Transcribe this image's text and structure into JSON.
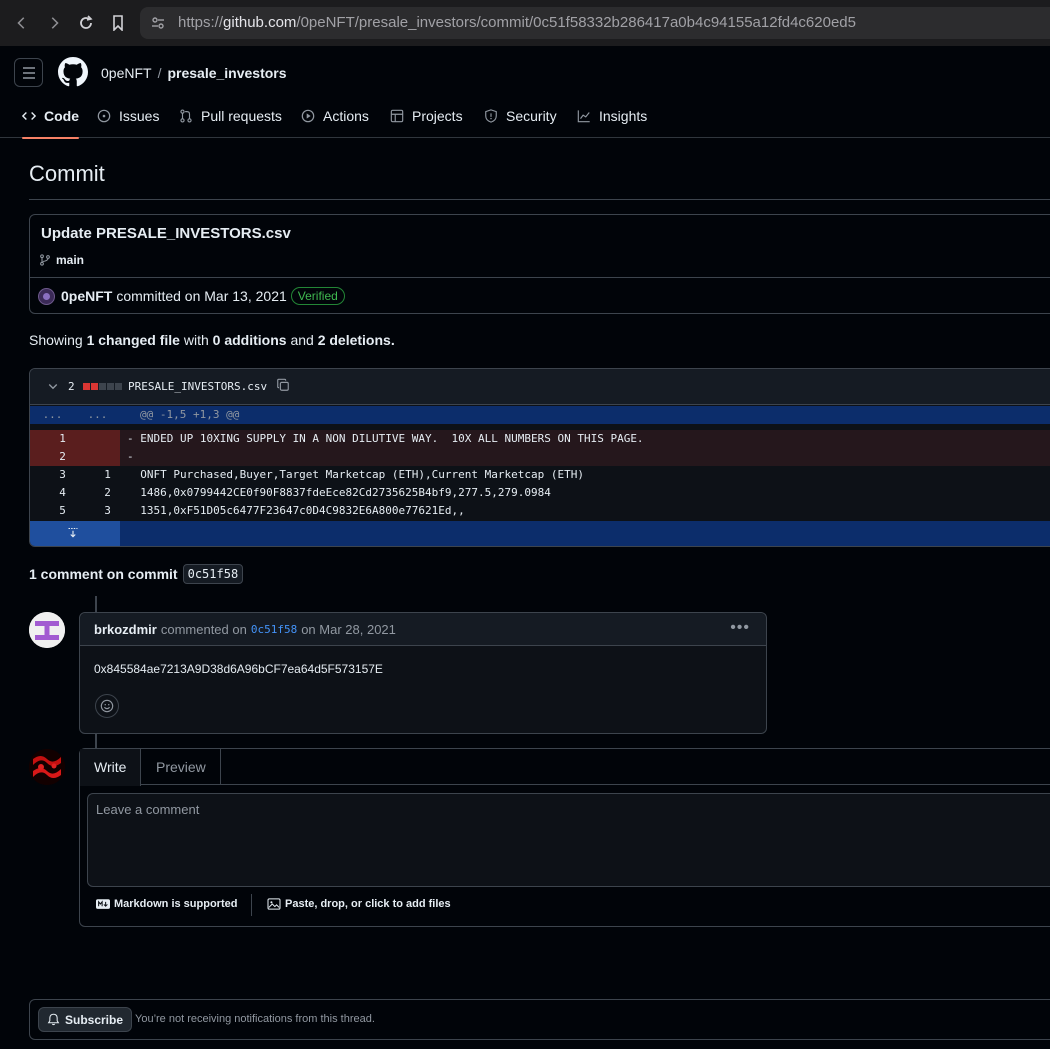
{
  "browser": {
    "url_prefix": "https://",
    "url_host": "github.com",
    "url_path": "/0peNFT/presale_investors/commit/0c51f58332b286417a0b4c94155a12fd4c620ed5"
  },
  "header": {
    "owner": "0peNFT",
    "separator": "/",
    "repo": "presale_investors",
    "tabs": [
      {
        "label": "Code",
        "icon": "code-icon"
      },
      {
        "label": "Issues",
        "icon": "issue-icon"
      },
      {
        "label": "Pull requests",
        "icon": "pull-request-icon"
      },
      {
        "label": "Actions",
        "icon": "play-icon"
      },
      {
        "label": "Projects",
        "icon": "table-icon"
      },
      {
        "label": "Security",
        "icon": "shield-icon"
      },
      {
        "label": "Insights",
        "icon": "graph-icon"
      }
    ]
  },
  "page": {
    "title": "Commit"
  },
  "commit": {
    "message": "Update PRESALE_INVESTORS.csv",
    "branch": "main",
    "author": "0peNFT",
    "committed_text": "committed on Mar 13, 2021",
    "verified": "Verified"
  },
  "summary": {
    "showing": "Showing",
    "changed": "1 changed file",
    "with": "with",
    "additions": "0 additions",
    "and": "and",
    "deletions": "2 deletions",
    "period": "."
  },
  "diff": {
    "count": "2",
    "filename": "PRESALE_INVESTORS.csv",
    "hunk": {
      "left": "...",
      "right": "...",
      "text": "@@ -1,5 +1,3 @@"
    },
    "lines": [
      {
        "old": "1",
        "new": "",
        "type": "del",
        "text": "- ENDED UP 10XING SUPPLY IN A NON DILUTIVE WAY.  10X ALL NUMBERS ON THIS PAGE."
      },
      {
        "old": "2",
        "new": "",
        "type": "del",
        "text": "-"
      },
      {
        "old": "3",
        "new": "1",
        "type": "ctx",
        "text": "  ONFT Purchased,Buyer,Target Marketcap (ETH),Current Marketcap (ETH)"
      },
      {
        "old": "4",
        "new": "2",
        "type": "ctx",
        "text": "  1486,0x0799442CE0f90F8837fdeEce82Cd2735625B4bf9,277.5,279.0984"
      },
      {
        "old": "5",
        "new": "3",
        "type": "ctx",
        "text": "  1351,0xF51D05c6477F23647c0D4C9832E6A800e77621Ed,,"
      }
    ]
  },
  "comments": {
    "heading": "1 comment on commit",
    "sha": "0c51f58",
    "items": [
      {
        "author": "brkozdmir",
        "commented_on": "commented on",
        "sha": "0c51f58",
        "date": "on Mar 28, 2021",
        "body": "0x845584ae7213A9D38d6A96bCF7ea64d5F573157E"
      }
    ]
  },
  "editor": {
    "tab_write": "Write",
    "tab_preview": "Preview",
    "placeholder": "Leave a comment",
    "markdown_note": "Markdown is supported",
    "attach_note": "Paste, drop, or click to add files"
  },
  "notifications": {
    "subscribe": "Subscribe",
    "text": "You’re not receiving notifications from this thread."
  },
  "colors": {
    "accent_tab_underline": "#f78166",
    "verified_green": "#3fb950",
    "link_blue": "#4493f8",
    "deletion_red": "#da3633"
  }
}
